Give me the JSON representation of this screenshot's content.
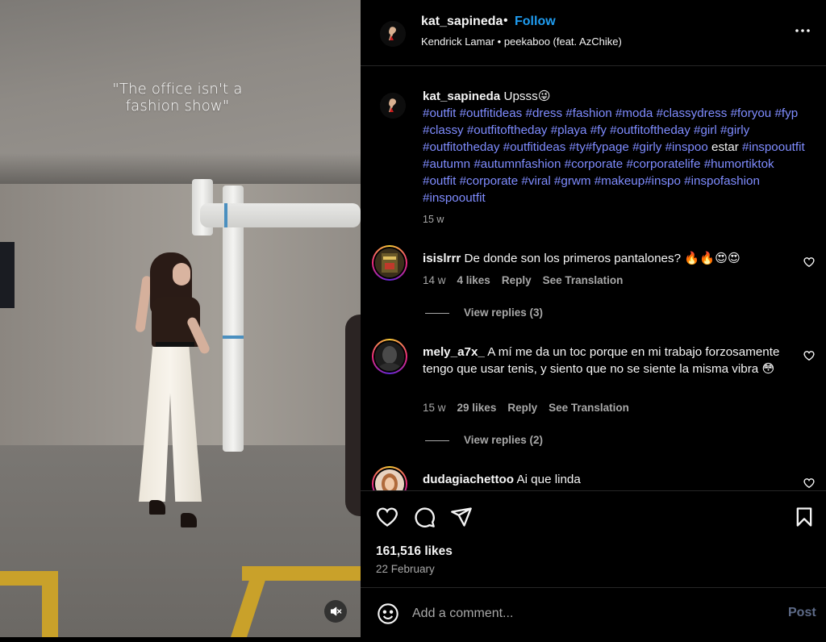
{
  "video": {
    "overlay_text": "\"The office isn't a fashion show\"",
    "mute_icon": "speaker-muted-icon"
  },
  "header": {
    "username": "kat_sapineda",
    "separator": "•",
    "follow_label": "Follow",
    "music": "Kendrick Lamar • peekaboo (feat. AzChike)",
    "more_icon": "more-horizontal-icon"
  },
  "caption": {
    "username": "kat_sapineda",
    "text": "Upsss😜",
    "tags_1": "#outfit #outfitideas #dress #fashion #moda #classydress #foryou #fyp #classy #outfitoftheday #playa #fy #outfitoftheday #girl #girly #outfitotheday #outfitideas #ty#fypage #girly #inspoo",
    "plain": " estar ",
    "tags_2": "#inspooutfit #autumn #autumnfashion #corporate #corporatelife #humortiktok #outfit #corporate #viral #grwm #makeup#inspo #inspofashion #inspooutfit",
    "time": "15 w"
  },
  "comments": [
    {
      "username": "isislrrr",
      "text": "De donde son los primeros pantalones? 🔥🔥😍😍",
      "time": "14 w",
      "likes": "4 likes",
      "reply": "Reply",
      "translate": "See Translation",
      "view_replies": "View replies (3)"
    },
    {
      "username": "mely_a7x_",
      "text": "A mí me da un toc porque en mi trabajo forzosamente tengo que usar tenis, y siento que no se siente la misma vibra 😳",
      "time": "15 w",
      "likes": "29 likes",
      "reply": "Reply",
      "translate": "See Translation",
      "view_replies": "View replies (2)"
    },
    {
      "username": "dudagiachettoo",
      "text": "Ai que linda"
    }
  ],
  "actions": {
    "like_icon": "heart-icon",
    "comment_icon": "comment-icon",
    "share_icon": "send-icon",
    "save_icon": "bookmark-icon",
    "likes": "161,516 likes",
    "date": "22 February"
  },
  "add_comment": {
    "placeholder": "Add a comment...",
    "post_label": "Post",
    "emoji_icon": "smiley-icon"
  },
  "colors": {
    "background": "#000000",
    "text": "#f5f5f5",
    "muted": "#a8a8a8",
    "follow": "#1f9cf0",
    "hashtag": "#7f8cff",
    "post_disabled": "#5d6a87"
  }
}
